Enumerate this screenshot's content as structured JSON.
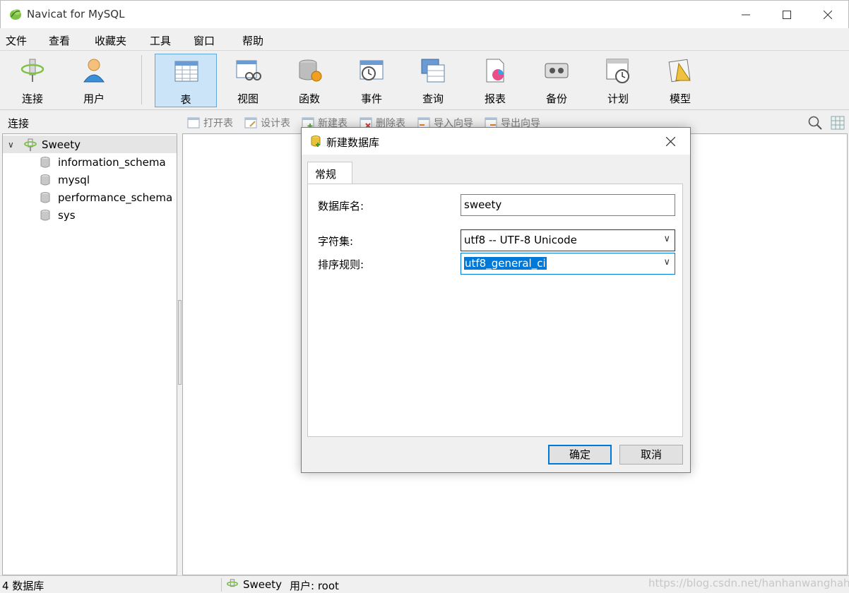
{
  "window": {
    "title": "Navicat for MySQL"
  },
  "menu": [
    "文件",
    "查看",
    "收藏夹",
    "工具",
    "窗口",
    "帮助"
  ],
  "toolbar": [
    {
      "label": "连接",
      "icon": "connection-icon"
    },
    {
      "label": "用户",
      "icon": "user-icon"
    },
    {
      "label": "表",
      "icon": "table-icon",
      "active": true
    },
    {
      "label": "视图",
      "icon": "view-icon"
    },
    {
      "label": "函数",
      "icon": "function-icon"
    },
    {
      "label": "事件",
      "icon": "event-icon"
    },
    {
      "label": "查询",
      "icon": "query-icon"
    },
    {
      "label": "报表",
      "icon": "report-icon"
    },
    {
      "label": "备份",
      "icon": "backup-icon"
    },
    {
      "label": "计划",
      "icon": "schedule-icon"
    },
    {
      "label": "模型",
      "icon": "model-icon"
    }
  ],
  "subbar": {
    "section_label": "连接",
    "actions": [
      "打开表",
      "设计表",
      "新建表",
      "删除表",
      "导入向导",
      "导出向导"
    ]
  },
  "tree": {
    "connection": "Sweety",
    "databases": [
      "information_schema",
      "mysql",
      "performance_schema",
      "sys"
    ]
  },
  "status": {
    "db_count": "4 数据库",
    "connection": "Sweety",
    "user": "用户: root",
    "watermark": "https://blog.csdn.net/hanhanwanghaha"
  },
  "dialog": {
    "title": "新建数据库",
    "tab": "常规",
    "fields": {
      "name_label": "数据库名:",
      "name_value": "sweety",
      "charset_label": "字符集:",
      "charset_value": "utf8 -- UTF-8 Unicode",
      "collation_label": "排序规则:",
      "collation_value": "utf8_general_ci"
    },
    "ok": "确定",
    "cancel": "取消"
  },
  "colors": {
    "accent": "#0078d7",
    "active_tool_bg": "#cce4f7",
    "active_tool_border": "#62a8dd"
  }
}
